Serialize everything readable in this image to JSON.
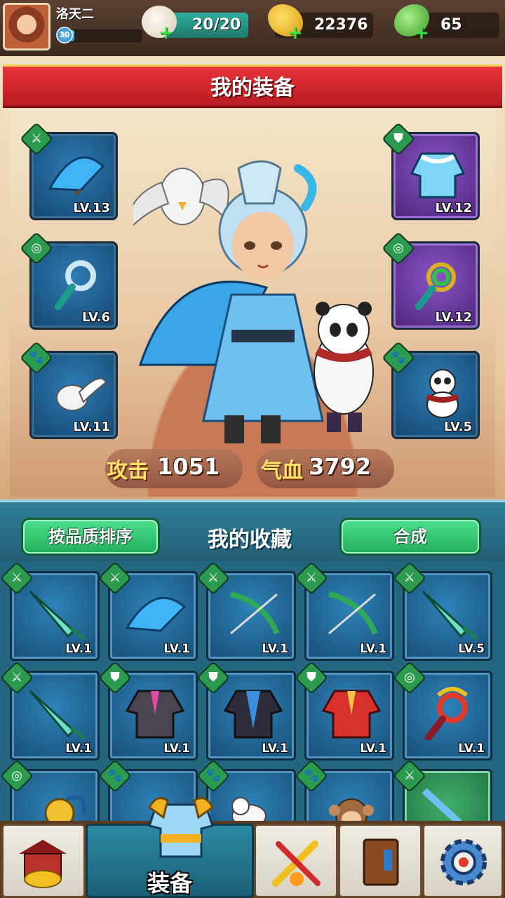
{
  "player": {
    "name": "洛天二",
    "level": "30",
    "exp_fraction": 0.18
  },
  "resources": {
    "stamina": "20/20",
    "gold": "22376",
    "jade": "65"
  },
  "equipment": {
    "title": "我的装备",
    "left_slots": [
      {
        "item": "blue-fan",
        "level": "LV.13",
        "quality": "blue",
        "badge": "weapon-icon"
      },
      {
        "item": "jade-pendant",
        "level": "LV.6",
        "quality": "blue",
        "badge": "accessory-icon"
      },
      {
        "item": "white-eagle-pet",
        "level": "LV.11",
        "quality": "blue",
        "badge": "paw-icon"
      }
    ],
    "right_slots": [
      {
        "item": "ice-robe",
        "level": "LV.12",
        "quality": "purple",
        "badge": "armor-icon"
      },
      {
        "item": "dragon-ring",
        "level": "LV.12",
        "quality": "purple",
        "badge": "accessory-icon"
      },
      {
        "item": "panda-pet",
        "level": "LV.5",
        "quality": "blue",
        "badge": "paw-icon"
      }
    ],
    "attack_label": "攻击",
    "attack_value": "1051",
    "hp_label": "气血",
    "hp_value": "3792"
  },
  "collection": {
    "sort_button": "按品质排序",
    "title": "我的收藏",
    "merge_button": "合成",
    "rows": [
      [
        {
          "item": "jade-dagger",
          "level": "LV.1",
          "badge": "weapon-icon"
        },
        {
          "item": "blue-fan",
          "level": "LV.1",
          "badge": "weapon-icon"
        },
        {
          "item": "jade-crossbow",
          "level": "LV.1",
          "badge": "weapon-icon"
        },
        {
          "item": "jade-crossbow",
          "level": "LV.1",
          "badge": "weapon-icon"
        },
        {
          "item": "jade-dagger",
          "level": "LV.5",
          "badge": "weapon-icon"
        }
      ],
      [
        {
          "item": "jade-dagger",
          "level": "LV.1",
          "badge": "weapon-icon"
        },
        {
          "item": "dark-robe",
          "level": "LV.1",
          "badge": "armor-icon"
        },
        {
          "item": "blue-robe",
          "level": "LV.1",
          "badge": "armor-icon"
        },
        {
          "item": "red-robe",
          "level": "LV.1",
          "badge": "armor-icon"
        },
        {
          "item": "phoenix-ring",
          "level": "LV.1",
          "badge": "accessory-icon"
        }
      ],
      [
        {
          "item": "golden-pendant",
          "level": "",
          "badge": "accessory-icon"
        },
        {
          "item": "pet",
          "level": "",
          "badge": "paw-icon"
        },
        {
          "item": "ferret-pet",
          "level": "",
          "badge": "paw-icon"
        },
        {
          "item": "monkey-pet",
          "level": "",
          "badge": "paw-icon"
        },
        {
          "item": "blue-sword",
          "level": "",
          "badge": "weapon-icon"
        }
      ]
    ]
  },
  "nav": {
    "active_label": "装备",
    "items": [
      "shop-icon",
      "equipment-icon",
      "weapon-forge-icon",
      "book-icon",
      "settings-icon"
    ]
  },
  "colors": {
    "banner_red": "#d62a30",
    "button_green": "#2fc46f",
    "collection_teal": "#24667f",
    "slot_blue": "#1e5f8f",
    "slot_purple": "#6a3aa2"
  }
}
